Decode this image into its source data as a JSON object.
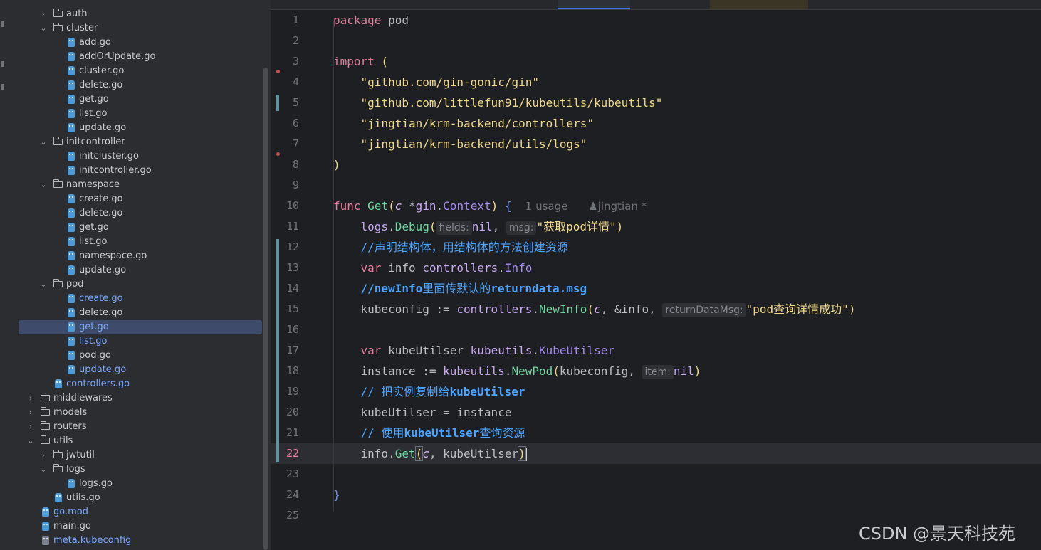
{
  "tree": [
    {
      "label": "auth",
      "kind": "folder",
      "expanded": false
    },
    {
      "label": "cluster",
      "kind": "folder",
      "expanded": true
    },
    {
      "label": "add.go",
      "kind": "go"
    },
    {
      "label": "addOrUpdate.go",
      "kind": "go"
    },
    {
      "label": "cluster.go",
      "kind": "go"
    },
    {
      "label": "delete.go",
      "kind": "go"
    },
    {
      "label": "get.go",
      "kind": "go"
    },
    {
      "label": "list.go",
      "kind": "go"
    },
    {
      "label": "update.go",
      "kind": "go"
    },
    {
      "label": "initcontroller",
      "kind": "folder",
      "expanded": true
    },
    {
      "label": "initcluster.go",
      "kind": "go"
    },
    {
      "label": "initcontroller.go",
      "kind": "go"
    },
    {
      "label": "namespace",
      "kind": "folder",
      "expanded": true
    },
    {
      "label": "create.go",
      "kind": "go"
    },
    {
      "label": "delete.go",
      "kind": "go"
    },
    {
      "label": "get.go",
      "kind": "go"
    },
    {
      "label": "list.go",
      "kind": "go"
    },
    {
      "label": "namespace.go",
      "kind": "go"
    },
    {
      "label": "update.go",
      "kind": "go"
    },
    {
      "label": "pod",
      "kind": "folder",
      "expanded": true
    },
    {
      "label": "create.go",
      "kind": "go",
      "modified": true
    },
    {
      "label": "delete.go",
      "kind": "go"
    },
    {
      "label": "get.go",
      "kind": "go",
      "modified": true,
      "selected": true
    },
    {
      "label": "list.go",
      "kind": "go",
      "modified": true
    },
    {
      "label": "pod.go",
      "kind": "go"
    },
    {
      "label": "update.go",
      "kind": "go",
      "modified": true
    },
    {
      "label": "controllers.go",
      "kind": "go",
      "modified": true
    },
    {
      "label": "middlewares",
      "kind": "folder",
      "expanded": false
    },
    {
      "label": "models",
      "kind": "folder",
      "expanded": false
    },
    {
      "label": "routers",
      "kind": "folder",
      "expanded": false
    },
    {
      "label": "utils",
      "kind": "folder",
      "expanded": true
    },
    {
      "label": "jwtutil",
      "kind": "folder",
      "expanded": false
    },
    {
      "label": "logs",
      "kind": "folder",
      "expanded": true
    },
    {
      "label": "logs.go",
      "kind": "go"
    },
    {
      "label": "utils.go",
      "kind": "go"
    },
    {
      "label": "go.mod",
      "kind": "go",
      "modified": true
    },
    {
      "label": "main.go",
      "kind": "go"
    },
    {
      "label": "meta.kubeconfig",
      "kind": "file",
      "modified": true
    }
  ],
  "editor": {
    "current_line": 22,
    "line_numbers": [
      "1",
      "2",
      "3",
      "4",
      "5",
      "6",
      "7",
      "8",
      "9",
      "10",
      "11",
      "12",
      "13",
      "14",
      "15",
      "16",
      "17",
      "18",
      "19",
      "20",
      "21",
      "22",
      "23",
      "24",
      "25"
    ],
    "code": {
      "l1_package": "package",
      "l1_name": " pod",
      "l3_import": "import",
      "l3_paren": " (",
      "l4_str": "\"github.com/gin-gonic/gin\"",
      "l5_str": "\"github.com/littlefun91/kubeutils/kubeutils\"",
      "l6_str": "\"jingtian/krm-backend/controllers\"",
      "l7_str": "\"jingtian/krm-backend/utils/logs\"",
      "l8_paren": ")",
      "l10_func": "func",
      "l10_name": "Get",
      "l10_open": "(",
      "l10_param": "c",
      "l10_star": " *",
      "l10_pkg": "gin",
      "l10_dot": ".",
      "l10_type": "Context",
      "l10_close": ")",
      "l10_brace": " {",
      "l10_usage": "1 usage",
      "l10_author": "jingtian *",
      "l11_pkg": "logs",
      "l11_dot": ".",
      "l11_fn": "Debug",
      "l11_open": "(",
      "l11_hint1": "fields:",
      "l11_nil": "nil",
      "l11_comma": ", ",
      "l11_hint2": "msg:",
      "l11_str": "\"获取pod详情\"",
      "l11_close": ")",
      "l12_cm": "//声明结构体，用结构体的方法创建资源",
      "l13_var": "var",
      "l13_name": " info ",
      "l13_pkg": "controllers",
      "l13_dot": ".",
      "l13_type": "Info",
      "l14_cm1": "//newInfo",
      "l14_cm2": "里面传默认的",
      "l14_cm3": "returndata.msg",
      "l15_lhs": "kubeconfig := ",
      "l15_pkg": "controllers",
      "l15_dot": ".",
      "l15_fn": "NewInfo",
      "l15_open": "(",
      "l15_c": "c",
      "l15_mid": ", &info, ",
      "l15_hint": "returnDataMsg:",
      "l15_str": "\"pod查询详情成功\"",
      "l15_close": ")",
      "l17_var": "var",
      "l17_name": " kubeUtilser ",
      "l17_pkg": "kubeutils",
      "l17_dot": ".",
      "l17_type": "KubeUtilser",
      "l18_lhs": "instance := ",
      "l18_pkg": "kubeutils",
      "l18_dot": ".",
      "l18_fn": "NewPod",
      "l18_open": "(",
      "l18_arg": "kubeconfig, ",
      "l18_hint": "item:",
      "l18_nil": "nil",
      "l18_close": ")",
      "l19_cm1": "// 把实例复制给",
      "l19_cm2": "kubeUtilser",
      "l20_text": "kubeUtilser = instance",
      "l21_cm1": "// 使用",
      "l21_cm2": "kubeUtilser",
      "l21_cm3": "查询资源",
      "l22_obj": "info.",
      "l22_fn": "Get",
      "l22_open": "(",
      "l22_c": "c",
      "l22_rest": ", kubeUtilser",
      "l22_close": ")",
      "l24_brace": "}"
    }
  },
  "watermark": "CSDN @景天科技苑",
  "colors": {
    "background": "#1e1f22",
    "sidebar": "#2b2d30",
    "selection": "#3f4b6b",
    "keyword": "#e37d9a",
    "string": "#f0d88b",
    "function": "#6fd6a0",
    "comment": "#4da4ff",
    "go_icon": "#4d9ad6"
  }
}
